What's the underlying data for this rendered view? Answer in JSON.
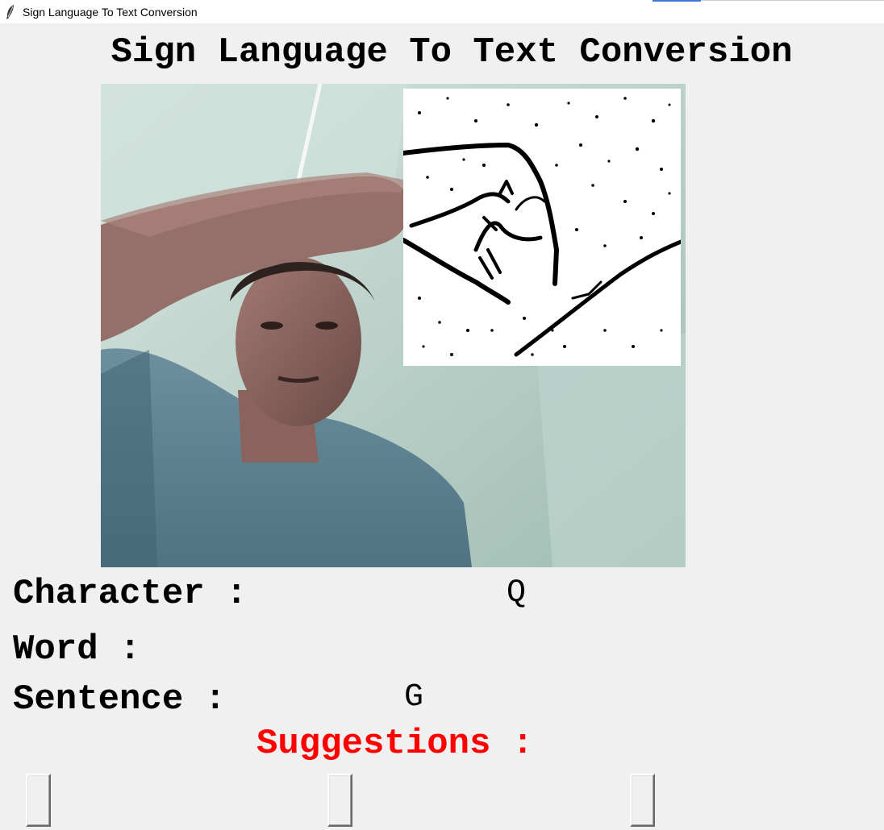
{
  "window": {
    "title": "Sign Language To Text Conversion",
    "icon": "feather-icon"
  },
  "header": {
    "title": "Sign Language To Text Conversion"
  },
  "camera": {
    "description_icon": "camera-feed"
  },
  "fields": {
    "character_label": "Character :",
    "character_value": "Q",
    "word_label": "Word :",
    "word_value": "",
    "sentence_label": "Sentence :",
    "sentence_value": "G"
  },
  "suggestions": {
    "label": "Suggestions :",
    "buttons": [
      "",
      "",
      ""
    ]
  },
  "colors": {
    "background": "#f0f0f0",
    "suggestions_label": "#ff0000",
    "text": "#000000"
  }
}
